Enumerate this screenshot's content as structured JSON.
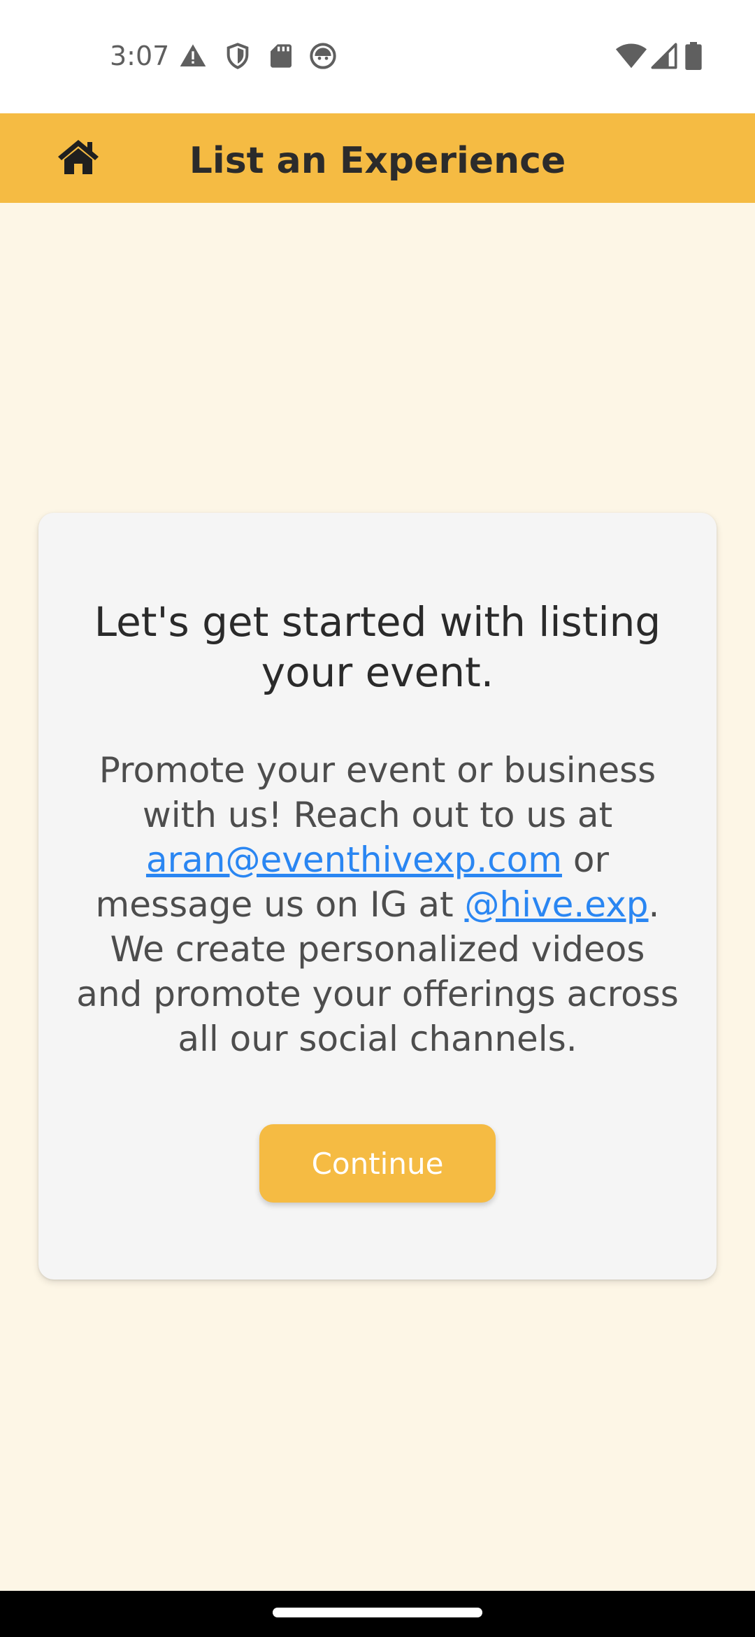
{
  "status_bar": {
    "time": "3:07",
    "left_icons": [
      "alert-icon",
      "shield-icon",
      "sd-card-icon",
      "robot-icon"
    ],
    "right_icons": [
      "wifi-icon",
      "cell-signal-icon",
      "battery-icon"
    ]
  },
  "app_bar": {
    "title": "List an Experience",
    "home_icon": "home-icon",
    "color": "#f5bb43"
  },
  "card": {
    "heading": "Let's get started with listing your event.",
    "body_part1": "Promote your event or business with us! Reach out to us at ",
    "email_link": "aran@eventhivexp.com",
    "body_part2": " or message us on IG at ",
    "ig_link": "@hive.exp",
    "body_part3": ". We create personalized videos and promote your offerings across all our social channels.",
    "continue_label": "Continue"
  },
  "colors": {
    "background": "#fdf6e6",
    "accent": "#f5bb43",
    "link": "#2a86f2"
  }
}
